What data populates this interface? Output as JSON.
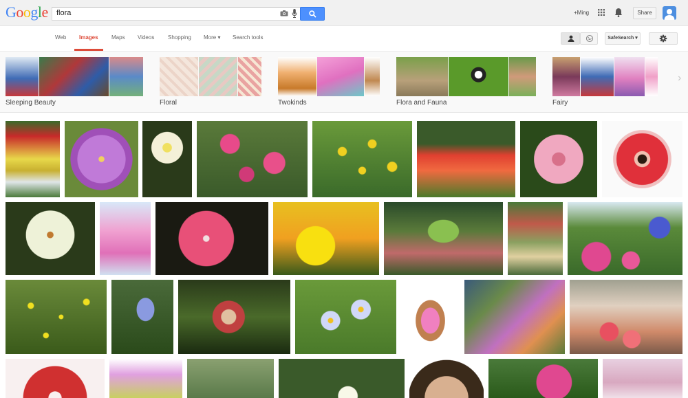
{
  "header": {
    "logo_letters": [
      {
        "ch": "G",
        "color": "#4285f4"
      },
      {
        "ch": "o",
        "color": "#ea4335"
      },
      {
        "ch": "o",
        "color": "#fbbc05"
      },
      {
        "ch": "g",
        "color": "#4285f4"
      },
      {
        "ch": "l",
        "color": "#34a853"
      },
      {
        "ch": "e",
        "color": "#ea4335"
      }
    ],
    "query": "flora",
    "plus_user": "+Ming",
    "share_label": "Share",
    "icons": [
      "camera-icon",
      "mic-icon",
      "search-icon",
      "apps-icon",
      "bell-icon",
      "avatar"
    ]
  },
  "nav": {
    "tabs": [
      "Web",
      "Images",
      "Maps",
      "Videos",
      "Shopping",
      "More ▾",
      "Search tools"
    ],
    "active_tab": "Images",
    "safesearch_label": "SafeSearch ▾",
    "accent_color": "#dd4b39"
  },
  "related": [
    {
      "label": "Sleeping Beauty"
    },
    {
      "label": "Floral"
    },
    {
      "label": "Twokinds"
    },
    {
      "label": "Flora and Fauna"
    },
    {
      "label": "Fairy"
    }
  ],
  "colors": {
    "brand_blue": "#4d90fe",
    "active_red": "#dd4b39"
  }
}
